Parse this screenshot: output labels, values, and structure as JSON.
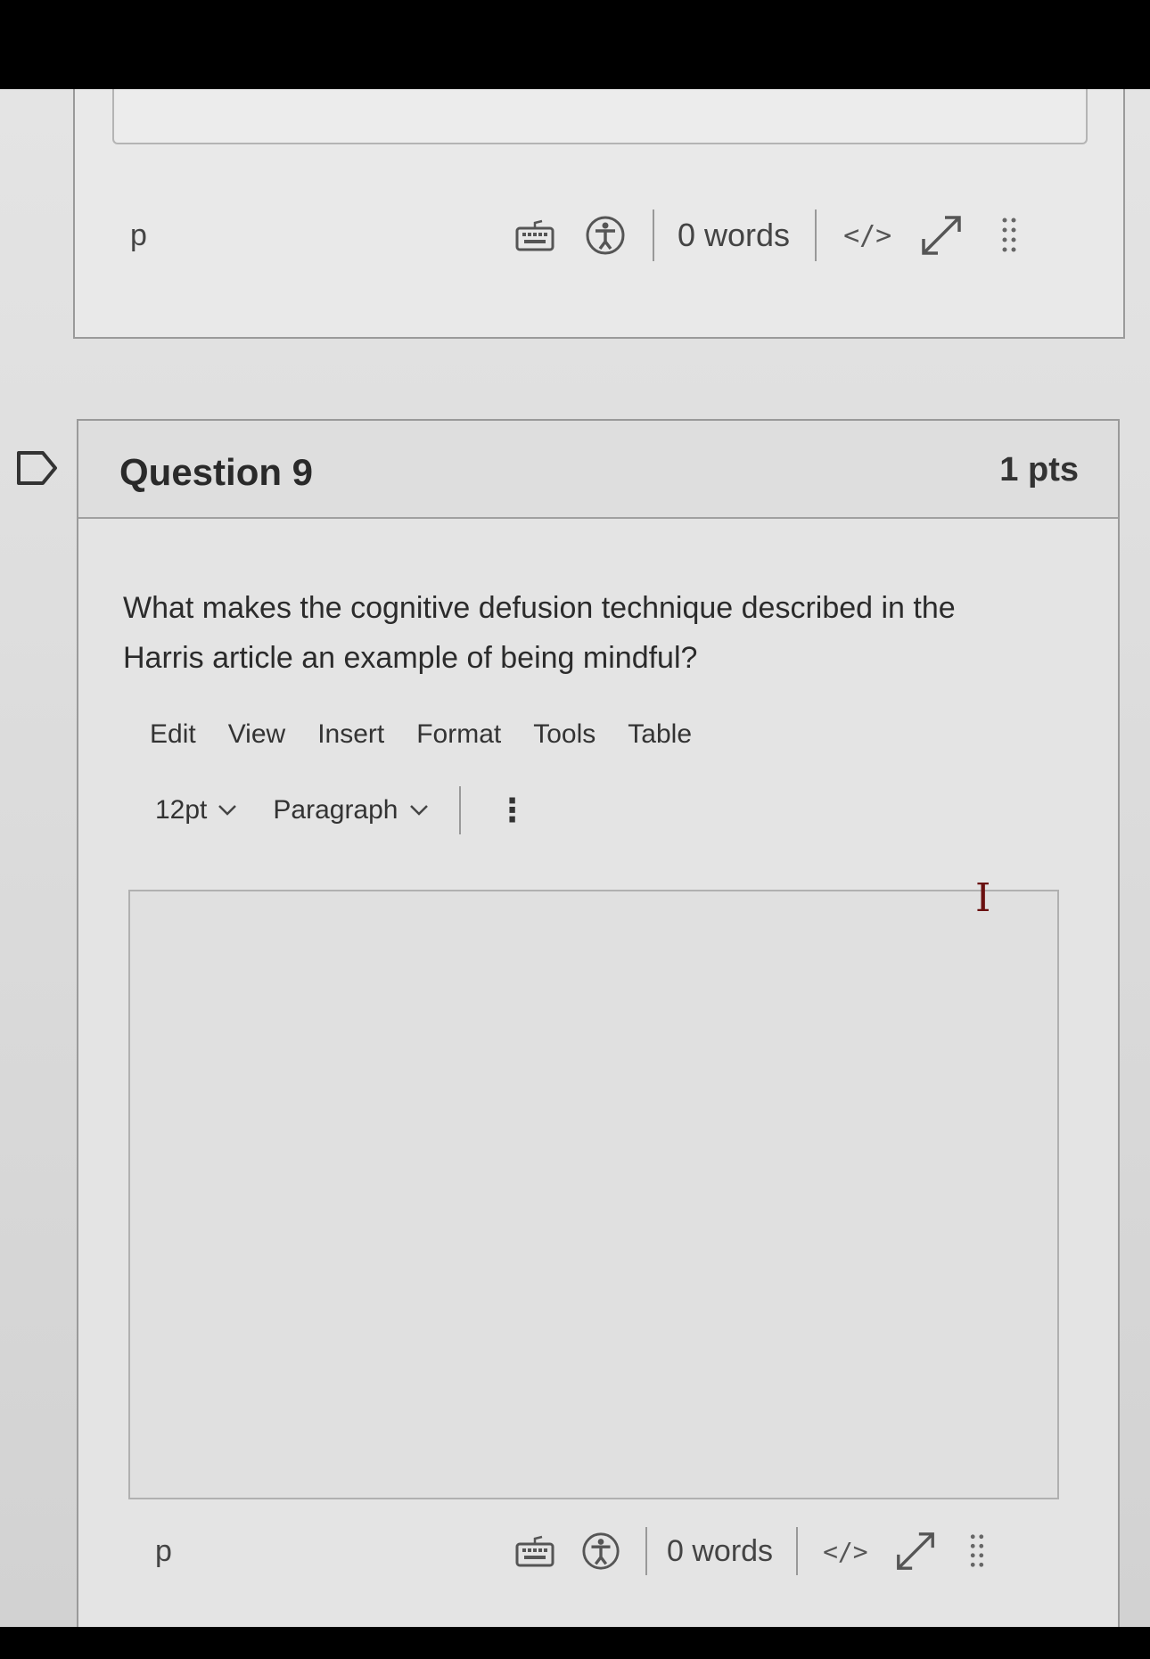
{
  "prev_editor": {
    "status": {
      "element_tag": "p",
      "word_count": "0 words",
      "code_label": "</>",
      "icons": [
        "keyboard-icon",
        "accessibility-icon",
        "fullscreen-icon",
        "drag-handle-icon"
      ]
    }
  },
  "question": {
    "title": "Question 9",
    "points": "1 pts",
    "text": "What makes the cognitive defusion technique described in the Harris article an example of being mindful?"
  },
  "editor": {
    "menu": [
      "Edit",
      "View",
      "Insert",
      "Format",
      "Tools",
      "Table"
    ],
    "font_size": "12pt",
    "block_format": "Paragraph",
    "more_label": "⋮",
    "status": {
      "element_tag": "p",
      "word_count": "0 words",
      "code_label": "</>"
    }
  }
}
